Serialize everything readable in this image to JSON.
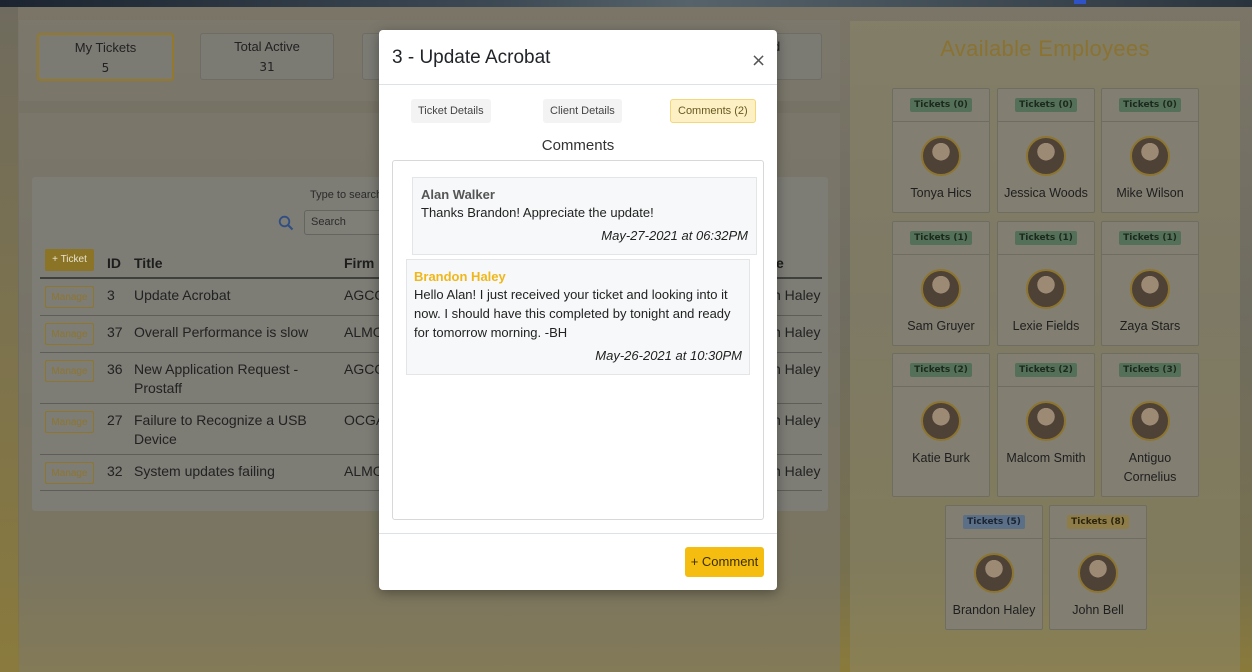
{
  "stats": [
    {
      "label": "My Tickets",
      "value": "5",
      "active": true
    },
    {
      "label": "Total Active",
      "value": "31",
      "active": false
    },
    {
      "label": "d",
      "value": "",
      "active": false
    }
  ],
  "table": {
    "search_hint": "Type to search",
    "search_placeholder": "Search",
    "add_label": "+ Ticket",
    "headers": {
      "id": "ID",
      "title": "Title",
      "firm": "Firm",
      "assigned": "e"
    },
    "manage_label": "Manage",
    "rows": [
      {
        "id": "3",
        "title": "Update Acrobat",
        "firm": "AGCO",
        "assigned": "n Haley"
      },
      {
        "id": "37",
        "title": "Overall Performance is slow",
        "firm": "ALMO",
        "assigned": "n Haley"
      },
      {
        "id": "36",
        "title": "New Application Request - Prostaff",
        "firm": "AGCO",
        "assigned": "n Haley"
      },
      {
        "id": "27",
        "title": "Failure to Recognize a USB Device",
        "firm": "OCGA",
        "assigned": "n Haley"
      },
      {
        "id": "32",
        "title": "System updates failing",
        "firm": "ALMO",
        "assigned": "n Haley"
      }
    ]
  },
  "employees": {
    "title": "Available Employees",
    "list": [
      {
        "name": "Tonya Hics",
        "tickets": "Tickets (0)",
        "badge": "green"
      },
      {
        "name": "Jessica Woods",
        "tickets": "Tickets (0)",
        "badge": "green"
      },
      {
        "name": "Mike Wilson",
        "tickets": "Tickets (0)",
        "badge": "green"
      },
      {
        "name": "Sam Gruyer",
        "tickets": "Tickets (1)",
        "badge": "green"
      },
      {
        "name": "Lexie Fields",
        "tickets": "Tickets (1)",
        "badge": "green"
      },
      {
        "name": "Zaya Stars",
        "tickets": "Tickets (1)",
        "badge": "green"
      },
      {
        "name": "Katie Burk",
        "tickets": "Tickets (2)",
        "badge": "green"
      },
      {
        "name": "Malcom Smith",
        "tickets": "Tickets (2)",
        "badge": "green"
      },
      {
        "name": "Antiguo Cornelius",
        "tickets": "Tickets (3)",
        "badge": "green"
      },
      {
        "name": "Brandon Haley",
        "tickets": "Tickets (5)",
        "badge": "blue"
      },
      {
        "name": "John Bell",
        "tickets": "Tickets (8)",
        "badge": "yellow"
      }
    ]
  },
  "modal": {
    "title": "3 - Update Acrobat",
    "close": "×",
    "tabs": [
      "Ticket Details",
      "Client Details",
      "Comments (2)"
    ],
    "active_tab": 2,
    "comments_heading": "Comments",
    "comments": [
      {
        "author": "Alan Walker",
        "text": "Thanks Brandon! Appreciate the update!",
        "date": "May-27-2021 at 06:32PM",
        "author_color": "#555555"
      },
      {
        "author": "Brandon Haley",
        "text": "Hello Alan! I just received your ticket and looking into it now. I should have this completed by tonight and ready for tomorrow morning. -BH",
        "date": "May-26-2021 at 10:30PM",
        "author_color": "#f0b71b"
      }
    ],
    "add_comment": "+ Comment"
  },
  "colors": {
    "accent": "#f5bd0f",
    "badge_green_bg": "#557058",
    "badge_blue_bg": "#5b6f86",
    "badge_yellow_bg": "#8e7d49"
  }
}
